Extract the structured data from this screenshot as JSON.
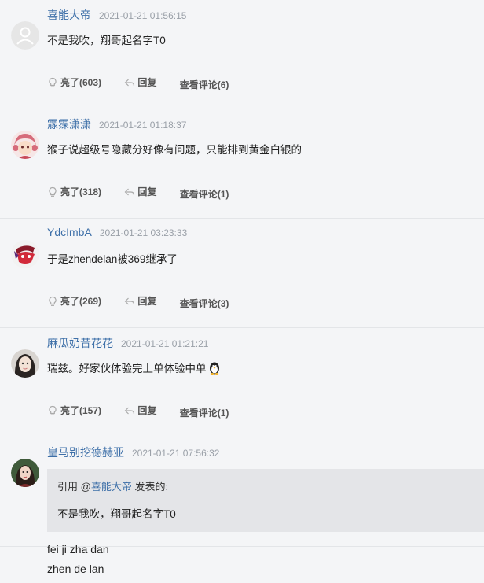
{
  "actions": {
    "reply_label": "回复"
  },
  "comments": [
    {
      "name": "喜能大帝",
      "time": "2021-01-21 01:56:15",
      "text": "不是我吹，翔哥起名字T0",
      "like_label": "亮了(603)",
      "view_label": "查看评论(6)",
      "avatar": "default-avatar"
    },
    {
      "name": "霡霂潇潇",
      "time": "2021-01-21 01:18:37",
      "text": "猴子说超级号隐藏分好像有问题，只能排到黄金白银的",
      "like_label": "亮了(318)",
      "view_label": "查看评论(1)",
      "avatar": "anime-girl-avatar"
    },
    {
      "name": "YdcImbA",
      "time": "2021-01-21 03:23:33",
      "text": "于是zhendelan被369继承了",
      "like_label": "亮了(269)",
      "view_label": "查看评论(3)",
      "avatar": "red-mask-avatar"
    },
    {
      "name": "麻瓜奶昔花花",
      "time": "2021-01-21 01:21:21",
      "text": "瑞兹。好家伙体验完上单体验中单",
      "like_label": "亮了(157)",
      "view_label": "查看评论(1)",
      "avatar": "girl-photo-avatar",
      "emoji": "penguin-emoji"
    },
    {
      "name": "皇马别挖德赫亚",
      "time": "2021-01-21 07:56:32",
      "avatar": "woman-photo-avatar",
      "quote": {
        "prefix": "引用 @",
        "quoted_name": "喜能大帝",
        "suffix": " 发表的:",
        "text": "不是我吹，翔哥起名字T0"
      },
      "reply_lines": [
        "fei ji zha dan",
        "zhen de lan"
      ]
    }
  ]
}
